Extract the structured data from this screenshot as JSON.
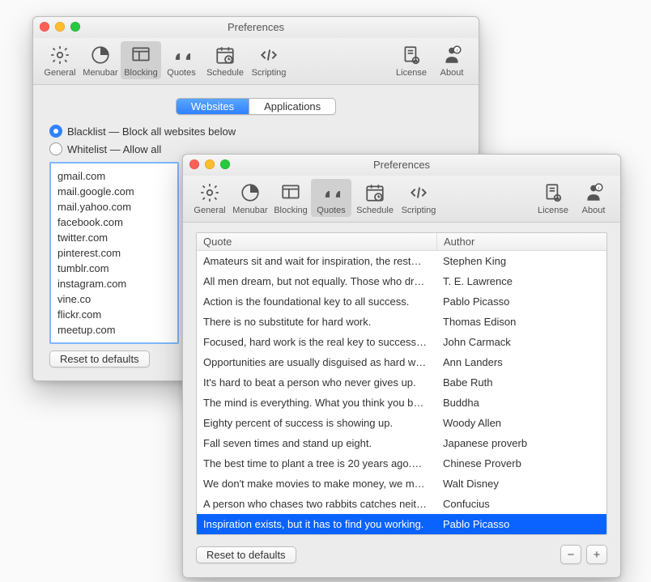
{
  "win_blocking": {
    "title": "Preferences",
    "toolbar": [
      {
        "id": "general",
        "label": "General"
      },
      {
        "id": "menubar",
        "label": "Menubar"
      },
      {
        "id": "blocking",
        "label": "Blocking",
        "selected": true
      },
      {
        "id": "quotes",
        "label": "Quotes"
      },
      {
        "id": "schedule",
        "label": "Schedule"
      },
      {
        "id": "scripting",
        "label": "Scripting"
      },
      {
        "id": "license",
        "label": "License"
      },
      {
        "id": "about",
        "label": "About"
      }
    ],
    "seg": {
      "websites": "Websites",
      "applications": "Applications",
      "active": "websites"
    },
    "radio_blacklist": "Blacklist — Block all websites below",
    "radio_whitelist": "Whitelist — Allow all",
    "selected_radio": "blacklist",
    "sites": [
      "gmail.com",
      "mail.google.com",
      "mail.yahoo.com",
      "facebook.com",
      "twitter.com",
      "pinterest.com",
      "tumblr.com",
      "instagram.com",
      "vine.co",
      "flickr.com",
      "meetup.com"
    ],
    "reset": "Reset to defaults"
  },
  "win_quotes": {
    "title": "Preferences",
    "toolbar": [
      {
        "id": "general",
        "label": "General"
      },
      {
        "id": "menubar",
        "label": "Menubar"
      },
      {
        "id": "blocking",
        "label": "Blocking"
      },
      {
        "id": "quotes",
        "label": "Quotes",
        "selected": true
      },
      {
        "id": "schedule",
        "label": "Schedule"
      },
      {
        "id": "scripting",
        "label": "Scripting"
      },
      {
        "id": "license",
        "label": "License"
      },
      {
        "id": "about",
        "label": "About"
      }
    ],
    "headers": {
      "quote": "Quote",
      "author": "Author"
    },
    "rows": [
      {
        "q": "Amateurs sit and wait for inspiration, the rest…",
        "a": "Stephen King"
      },
      {
        "q": "All men dream, but not equally. Those who dr…",
        "a": "T. E. Lawrence"
      },
      {
        "q": "Action is the foundational key to all success.",
        "a": "Pablo Picasso"
      },
      {
        "q": "There is no substitute for hard work.",
        "a": "Thomas Edison"
      },
      {
        "q": "Focused, hard work is the real key to success…",
        "a": "John Carmack"
      },
      {
        "q": "Opportunities are usually disguised as hard w…",
        "a": "Ann Landers"
      },
      {
        "q": "It's hard to beat a person who never gives up.",
        "a": "Babe Ruth"
      },
      {
        "q": "The mind is everything. What you think you b…",
        "a": "Buddha"
      },
      {
        "q": "Eighty percent of success is showing up.",
        "a": "Woody Allen"
      },
      {
        "q": "Fall seven times and stand up eight.",
        "a": "Japanese proverb"
      },
      {
        "q": "The best time to plant a tree is 20 years ago.…",
        "a": "Chinese Proverb"
      },
      {
        "q": "We don't make movies to make money, we m…",
        "a": "Walt Disney"
      },
      {
        "q": "A person who chases two rabbits catches neither.",
        "a": "Confucius"
      },
      {
        "q": "Inspiration exists, but it has to find you working.",
        "a": "Pablo Picasso",
        "selected": true
      }
    ],
    "reset": "Reset to defaults"
  }
}
